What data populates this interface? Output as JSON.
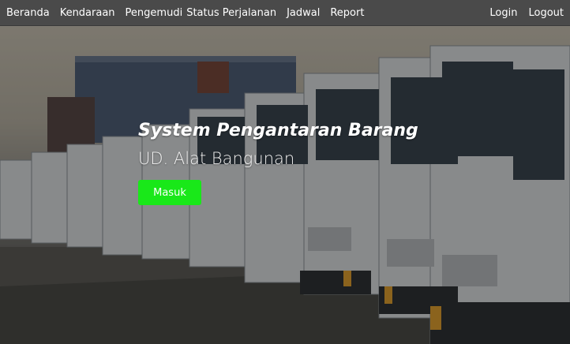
{
  "navbar": {
    "left_links": [
      "Beranda",
      "Kendaraan",
      "Pengemudi",
      "Status Perjalanan",
      "Jadwal",
      "Report"
    ],
    "right_links": [
      "Login",
      "Logout"
    ],
    "background": "#4a4a4a"
  },
  "hero": {
    "title": "System Pengantaran Barang",
    "subtitle": "UD. Alat Bangunan",
    "button_label": "Masuk",
    "button_color": "#19e819",
    "background_image": "row-of-white-trucks-photo"
  }
}
